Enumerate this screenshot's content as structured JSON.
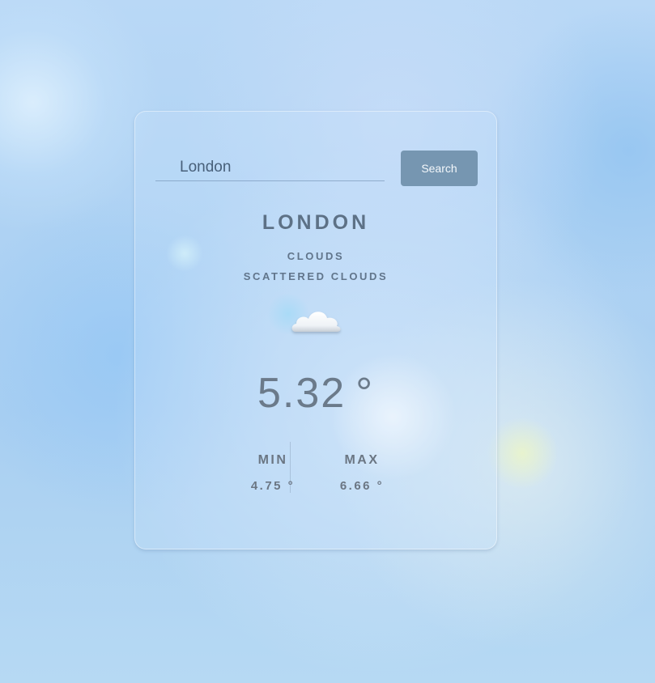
{
  "search": {
    "value": "London",
    "button_label": "Search"
  },
  "weather": {
    "city": "LONDON",
    "condition": "CLOUDS",
    "description": "SCATTERED CLOUDS",
    "icon": "cloud-icon",
    "temperature": "5.32",
    "temperature_unit": "°",
    "min_label": "MIN",
    "min_value": "4.75 °",
    "max_label": "MAX",
    "max_value": "6.66 °"
  },
  "colors": {
    "button": "#7696b1",
    "text": "#5d7186"
  }
}
